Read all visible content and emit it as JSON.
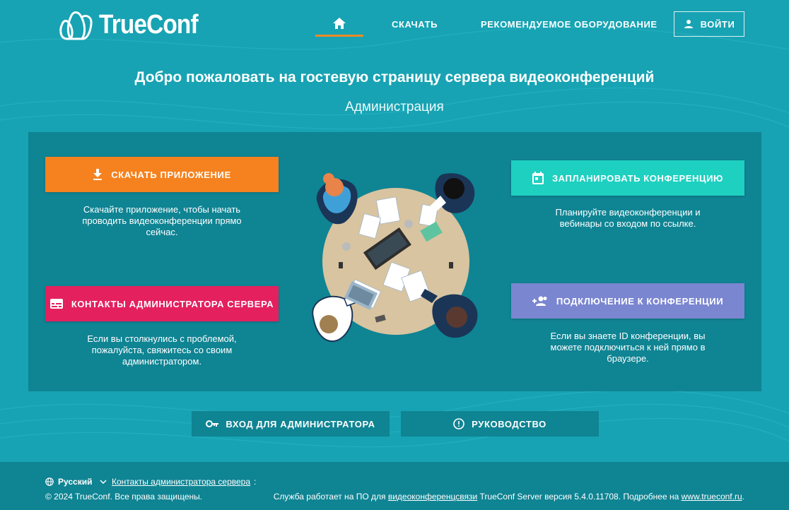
{
  "header": {
    "logo_text": "TrueConf",
    "nav": {
      "home_icon": "home-icon",
      "download": "СКАЧАТЬ",
      "equipment": "РЕКОМЕНДУЕМОЕ ОБОРУДОВАНИЕ"
    },
    "login": "ВОЙТИ",
    "accent_color": "#f08a24"
  },
  "welcome": {
    "title": "Добро пожаловать на гостевую страницу сервера видеоконференций",
    "subtitle": "Администрация"
  },
  "cards": {
    "download": {
      "label": "СКАЧАТЬ ПРИЛОЖЕНИЕ",
      "icon": "download-icon",
      "color": "#f5821f",
      "description": "Скачайте приложение, чтобы начать проводить видеоконференции прямо сейчас."
    },
    "contacts": {
      "label": "КОНТАКТЫ АДМИНИСТРАТОРА СЕРВЕРА",
      "icon": "contact-card-icon",
      "color": "#e4205f",
      "description": "Если вы столкнулись с проблемой, пожалуйста, свяжитесь со своим администратором."
    },
    "schedule": {
      "label": "ЗАПЛАНИРОВАТЬ КОНФЕРЕНЦИЮ",
      "icon": "calendar-icon",
      "color": "#1ed0c0",
      "description": "Планируйте видеоконференции и вебинары со входом по ссылке."
    },
    "join": {
      "label": "ПОДКЛЮЧЕНИЕ К КОНФЕРЕНЦИИ",
      "icon": "add-people-icon",
      "color": "#7b86d0",
      "description": "Если вы знаете ID конференции, вы можете подключиться к ней прямо в браузере."
    }
  },
  "bottom": {
    "admin_login": "ВХОД ДЛЯ АДМИНИСТРАТОРА",
    "guide": "РУКОВОДСТВО"
  },
  "footer": {
    "language": "Русский",
    "contacts_link": "Контакты администратора сервера",
    "colon": ":",
    "copyright": "© 2024 TrueConf. Все права защищены.",
    "service_prefix": "Служба работает на ПО для",
    "service_link": "видеоконференцсвязи",
    "service_version": "TrueConf Server версия 5.4.0.11708. Подробнее на",
    "site_link": "www.trueconf.ru",
    "service_suffix": "."
  },
  "colors": {
    "background": "#17a3b3",
    "panel": "#0f8493"
  }
}
